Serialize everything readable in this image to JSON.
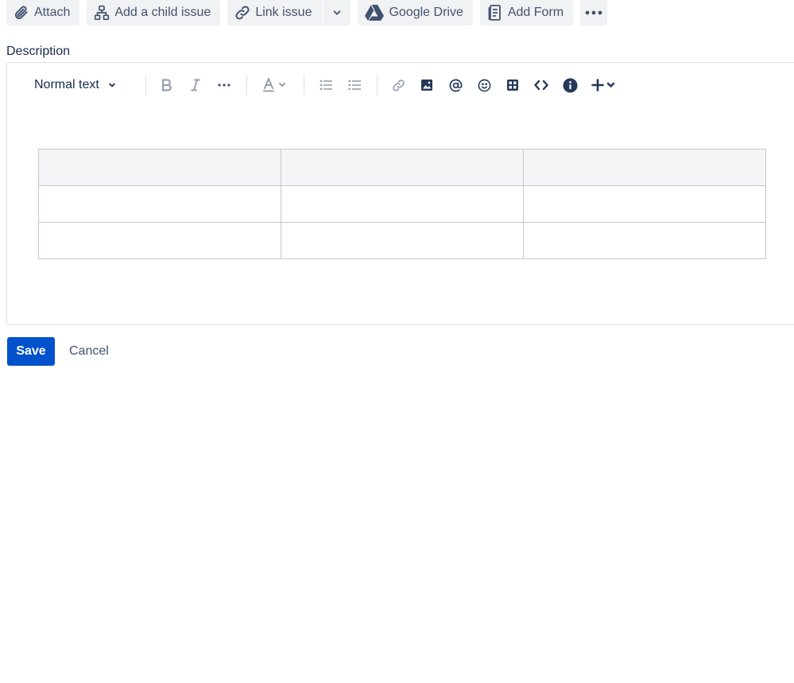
{
  "actions": {
    "attach": "Attach",
    "add_child": "Add a child issue",
    "link_issue": "Link issue",
    "google_drive": "Google Drive",
    "add_form": "Add Form"
  },
  "description": {
    "label": "Description",
    "text_style": "Normal text"
  },
  "toolbar_icons": [
    "bold-icon",
    "italic-icon",
    "more-formatting-icon",
    "text-color-icon",
    "bullet-list-icon",
    "numbered-list-icon",
    "link-icon",
    "image-icon",
    "mention-icon",
    "emoji-icon",
    "table-icon",
    "code-icon",
    "info-panel-icon",
    "insert-plus-icon"
  ],
  "table": {
    "rows": 3,
    "columns": 3,
    "header_row": true
  },
  "footer": {
    "save": "Save",
    "cancel": "Cancel"
  },
  "colors": {
    "primary": "#0052cc",
    "button_bg": "#f1f2f4",
    "border": "#dfe1e6",
    "text": "#172b4d"
  }
}
